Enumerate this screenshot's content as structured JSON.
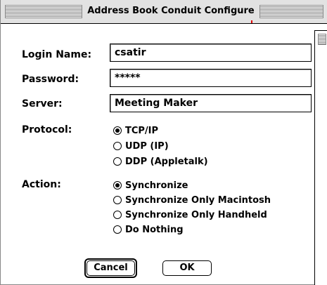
{
  "window": {
    "title": "Address Book Conduit Configure"
  },
  "form": {
    "login_label": "Login Name:",
    "login_value": "csatir",
    "password_label": "Password:",
    "password_value": "*****",
    "server_label": "Server:",
    "server_value": "Meeting Maker",
    "protocol_label": "Protocol:",
    "protocol_options": [
      {
        "label": "TCP/IP",
        "selected": true
      },
      {
        "label": "UDP (IP)",
        "selected": false
      },
      {
        "label": "DDP (Appletalk)",
        "selected": false
      }
    ],
    "action_label": "Action:",
    "action_options": [
      {
        "label": "Synchronize",
        "selected": true
      },
      {
        "label": "Synchronize Only Macintosh",
        "selected": false
      },
      {
        "label": "Synchronize Only Handheld",
        "selected": false
      },
      {
        "label": "Do Nothing",
        "selected": false
      }
    ]
  },
  "buttons": {
    "cancel_label": "Cancel",
    "ok_label": "OK"
  }
}
